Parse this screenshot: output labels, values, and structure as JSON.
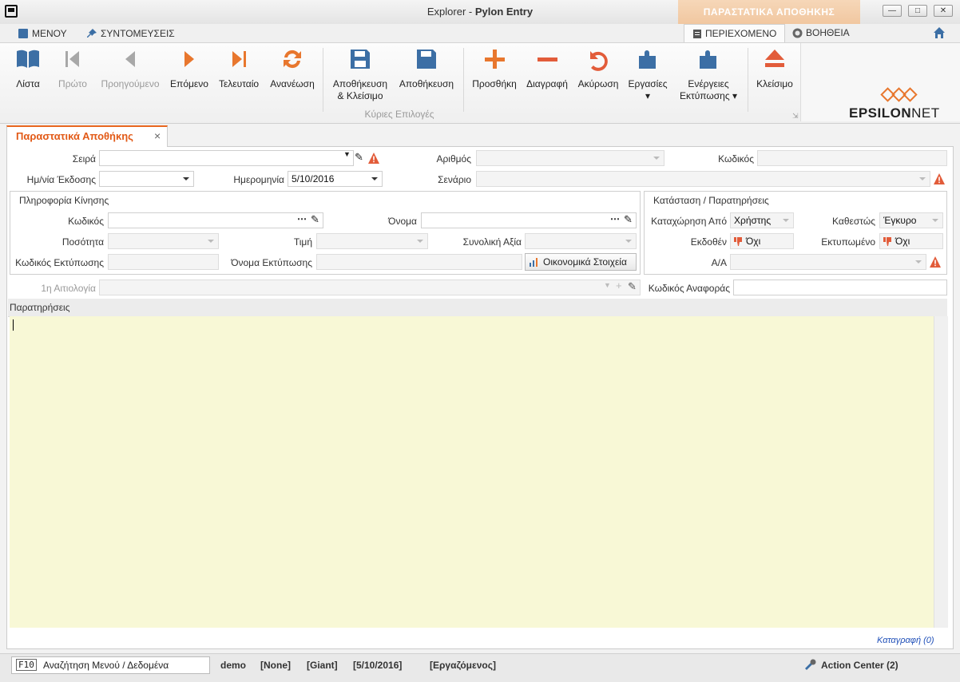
{
  "window": {
    "title_prefix": "Explorer - ",
    "title_app": "Pylon Entry",
    "context_tab": "ΠΑΡΑΣΤΑΤΙΚΑ ΑΠΟΘΗΚΗΣ",
    "buttons": [
      "minimize-icon",
      "maximize-icon",
      "close-icon"
    ]
  },
  "menu": {
    "main": "ΜΕΝΟΥ",
    "shortcuts": "ΣΥΝΤΟΜΕΥΣΕΙΣ",
    "content_tab": "ΠΕΡΙΕΧΟΜΕΝΟ",
    "help_tab": "ΒΟΗΘΕΙΑ"
  },
  "ribbon": {
    "list": "Λίστα",
    "first": "Πρώτο",
    "previous": "Προηγούμενο",
    "next": "Επόμενο",
    "last": "Τελευταίο",
    "refresh": "Ανανέωση",
    "save_close_1": "Αποθήκευση",
    "save_close_2": "& Κλείσιμο",
    "save": "Αποθήκευση",
    "add": "Προσθήκη",
    "delete": "Διαγραφή",
    "cancel": "Ακύρωση",
    "tasks": "Εργασίες",
    "print_actions_1": "Ενέργειες",
    "print_actions_2": "Εκτύπωσης",
    "close": "Κλείσιμο",
    "group_label": "Κύριες Επιλογές",
    "accent_color": "#e8772e",
    "icon_blue": "#3c6fa5"
  },
  "logo": {
    "part1": "EPSILON",
    "part2": "NET"
  },
  "document_tab": {
    "label": "Παραστατικά Αποθήκης",
    "close": "×"
  },
  "form": {
    "series_label": "Σειρά",
    "series_value": "",
    "number_label": "Αριθμός",
    "code_label": "Κωδικός",
    "issue_date_label": "Ημ/νία Έκδοσης",
    "date_label": "Ημερομηνία",
    "date_value": "5/10/2016",
    "scenario_label": "Σενάριο",
    "movement_group": "Πληροφορία Κίνησης",
    "item_code_label": "Κωδικός",
    "name_label": "Όνομα",
    "quantity_label": "Ποσότητα",
    "price_label": "Τιμή",
    "total_label": "Συνολική Αξία",
    "print_code_label": "Κωδικός Εκτύπωσης",
    "print_name_label": "Όνομα Εκτύπωσης",
    "financials_button": "Οικονομικά Στοιχεία",
    "status_group": "Κατάσταση / Παρατηρήσεις",
    "entry_by_label": "Καταχώρηση Από",
    "entry_by_value": "Χρήστης",
    "state_label": "Καθεστώς",
    "state_value": "Έγκυρο",
    "issued_label": "Εκδοθέν",
    "issued_value": "Όχι",
    "printed_label": "Εκτυπωμένο",
    "printed_value": "Όχι",
    "aa_label": "Α/Α",
    "reason_label": "1η Αιτιολογία",
    "ref_code_label": "Κωδικός Αναφοράς",
    "notes_label": "Παρατηρήσεις",
    "notes_value": "",
    "record_link": "Καταγραφή (0)"
  },
  "status": {
    "hotkey": "F10",
    "search_text": "Αναζήτηση Μενού / Δεδομένα",
    "user": "demo",
    "none": "[None]",
    "company": "[Giant]",
    "date": "[5/10/2016]",
    "mode": "[Εργαζόμενος]",
    "action_center": "Action Center (2)"
  }
}
